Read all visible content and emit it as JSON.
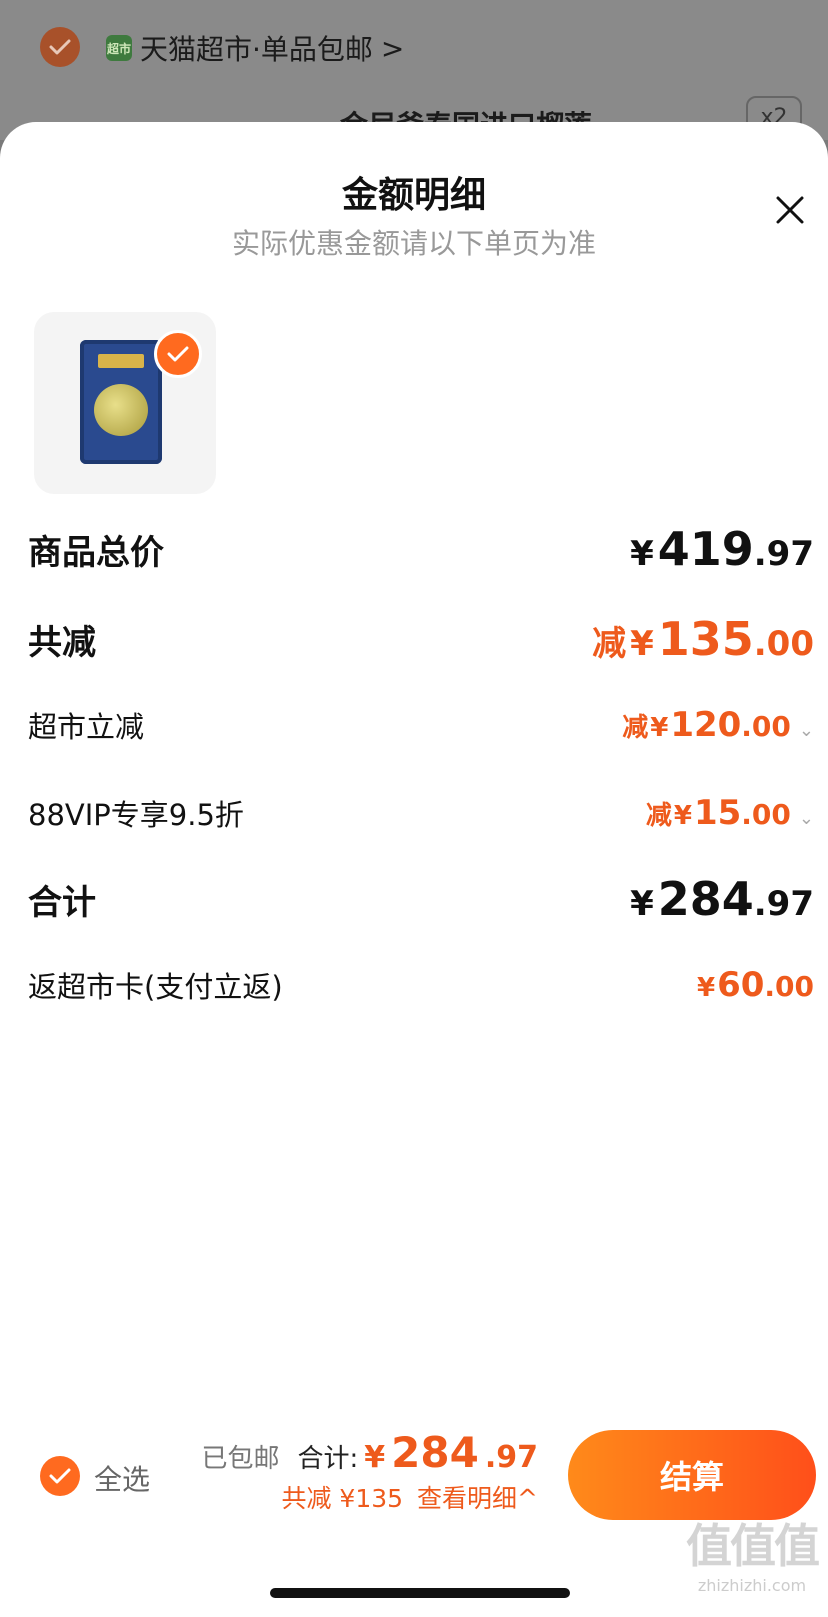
{
  "background_cart": {
    "store_icon_text": "超市",
    "store_name": "天猫超市·单品包邮",
    "store_chevron": ">",
    "product_title": "金尼斧泰国进口榴莲",
    "quantity": "x2"
  },
  "sheet": {
    "title": "金额明细",
    "subtitle": "实际优惠金额请以下单页为准"
  },
  "rows": {
    "goods_total": {
      "label": "商品总价",
      "yen": "¥",
      "int": "419",
      "dec": ".97"
    },
    "total_discount": {
      "label": "共减",
      "prefix": "减",
      "yen": "¥",
      "int": "135",
      "dec": ".00"
    },
    "market_discount": {
      "label": "超市立减",
      "prefix": "减",
      "yen": "¥",
      "int": "120",
      "dec": ".00"
    },
    "vip_discount": {
      "label": "88VIP专享9.5折",
      "prefix": "减",
      "yen": "¥",
      "int": "15",
      "dec": ".00"
    },
    "subtotal": {
      "label": "合计",
      "yen": "¥",
      "int": "284",
      "dec": ".97"
    },
    "cashback": {
      "label": "返超市卡(支付立返)",
      "yen": "¥",
      "int": "60",
      "dec": ".00"
    }
  },
  "bottom": {
    "select_all": "全选",
    "free_shipping": "已包邮",
    "total_label": "合计:",
    "total_yen": "¥",
    "total_int": "284",
    "total_dec": ".97",
    "discount_note": "共减 ¥135",
    "detail_link": "查看明细^",
    "checkout": "结算"
  },
  "watermark": {
    "glyphs": "值值值",
    "url": "zhizhizhi.com"
  },
  "colors": {
    "accent": "#ee5a1c",
    "checkout_gradient_start": "#ff8a1a",
    "checkout_gradient_end": "#ff4f1a"
  }
}
